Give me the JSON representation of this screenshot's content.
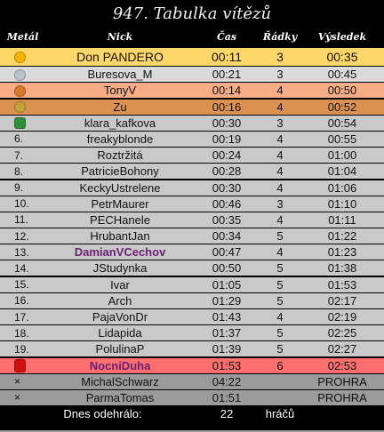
{
  "title": "947. Tabulka vítězů",
  "headers": {
    "medal": "Metál",
    "nick": "Nick",
    "time": "Čas",
    "rows": "Řádky",
    "result": "Výsledek"
  },
  "rows": [
    {
      "medal": "1",
      "icon": "gold-medal-icon",
      "nick": "Don PANDERO",
      "time": "00:11",
      "rows": "3",
      "result": "00:35",
      "style": "gold"
    },
    {
      "medal": "2",
      "icon": "silver-medal-icon",
      "nick": "Buresova_M",
      "time": "00:21",
      "rows": "3",
      "result": "00:45",
      "style": "silver"
    },
    {
      "medal": "3",
      "icon": "bronze-medal-icon",
      "nick": "TonyV",
      "time": "00:14",
      "rows": "4",
      "result": "00:50",
      "style": "bronze"
    },
    {
      "medal": "",
      "icon": "potato-icon",
      "nick": "Zu",
      "time": "00:16",
      "rows": "4",
      "result": "00:52",
      "style": "bronze2"
    },
    {
      "medal": "",
      "icon": "dino-icon",
      "nick": "klara_kafkova",
      "time": "00:30",
      "rows": "3",
      "result": "00:54",
      "style": "plain"
    },
    {
      "medal": "6.",
      "nick": "freakyblonde",
      "time": "00:19",
      "rows": "4",
      "result": "00:55",
      "style": "plain"
    },
    {
      "medal": "7.",
      "nick": "Roztržitá",
      "time": "00:24",
      "rows": "4",
      "result": "01:00",
      "style": "plain"
    },
    {
      "medal": "8.",
      "nick": "PatricieBohony",
      "time": "00:28",
      "rows": "4",
      "result": "01:04",
      "style": "plain"
    },
    {
      "medal": "9.",
      "nick": "KeckyUstrelene",
      "time": "00:30",
      "rows": "4",
      "result": "01:06",
      "style": "plain"
    },
    {
      "medal": "10.",
      "nick": "PetrMaurer",
      "time": "00:46",
      "rows": "3",
      "result": "01:10",
      "style": "plain"
    },
    {
      "medal": "11.",
      "nick": "PECHanele",
      "time": "00:35",
      "rows": "4",
      "result": "01:11",
      "style": "plain"
    },
    {
      "medal": "12.",
      "nick": "HrubantJan",
      "time": "00:34",
      "rows": "5",
      "result": "01:22",
      "style": "plain"
    },
    {
      "medal": "13.",
      "nick": "DamianVCechov",
      "time": "00:47",
      "rows": "4",
      "result": "01:23",
      "style": "accent"
    },
    {
      "medal": "14.",
      "nick": "JStudynka",
      "time": "00:50",
      "rows": "5",
      "result": "01:38",
      "style": "plain"
    },
    {
      "medal": "15.",
      "nick": "Ivar",
      "time": "01:05",
      "rows": "5",
      "result": "01:53",
      "style": "plain"
    },
    {
      "medal": "16.",
      "nick": "Arch",
      "time": "01:29",
      "rows": "5",
      "result": "02:17",
      "style": "plain"
    },
    {
      "medal": "17.",
      "nick": "PajaVonDr",
      "time": "01:43",
      "rows": "4",
      "result": "02:19",
      "style": "plain"
    },
    {
      "medal": "18.",
      "nick": "Lidapida",
      "time": "01:37",
      "rows": "5",
      "result": "02:25",
      "style": "plain"
    },
    {
      "medal": "19.",
      "nick": "PolulinaP",
      "time": "01:39",
      "rows": "5",
      "result": "02:27",
      "style": "plain"
    },
    {
      "medal": "",
      "icon": "red-marker-icon",
      "nick": "NocniDuha",
      "time": "01:53",
      "rows": "6",
      "result": "02:53",
      "style": "red"
    },
    {
      "medal": "×",
      "nick": "MichalSchwarz",
      "time": "04:22",
      "rows": "",
      "result": "PROHRA",
      "style": "dark"
    },
    {
      "medal": "×",
      "nick": "ParmaTomas",
      "time": "01:51",
      "rows": "",
      "result": "PROHRA",
      "style": "dark"
    }
  ],
  "footer": {
    "label": "Dnes odehrálo:",
    "count": "22",
    "unit": "hráčů"
  },
  "colors": {
    "gold": "#fdd76a",
    "silver": "#dadada",
    "bronze": "#f6ad86",
    "bronze2": "#dd9150",
    "plain": "#c9c9c9",
    "red": "#fb6f6f",
    "dark": "#9b9b9b",
    "accent_text": "#6b1f75"
  }
}
